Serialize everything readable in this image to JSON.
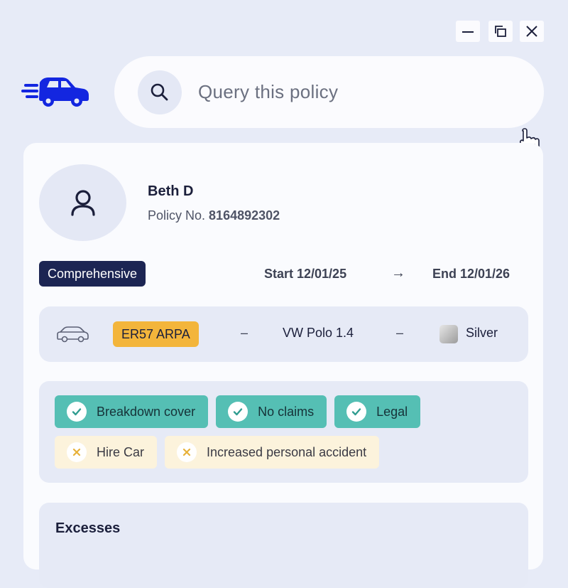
{
  "window_controls": {
    "minimize_icon": "minimize-icon",
    "restore_icon": "restore-icon",
    "close_icon": "close-icon"
  },
  "brand": {
    "logo_icon": "fast-car-icon",
    "accent_color": "#1326e0"
  },
  "search": {
    "placeholder": "Query this policy",
    "icon": "search-icon"
  },
  "policy": {
    "holder_name": "Beth D",
    "policy_no_label": "Policy No.",
    "policy_no": "8164892302",
    "cover_type": "Comprehensive",
    "start": "Start 12/01/25",
    "arrow": "→",
    "end": "End 12/01/26"
  },
  "vehicle": {
    "icon": "car-outline-icon",
    "registration": "ER57 ARPA",
    "separator": "–",
    "model": "VW Polo 1.4",
    "color": "Silver",
    "plate_color": "#f3b53b"
  },
  "features": [
    {
      "label": "Breakdown cover",
      "included": true
    },
    {
      "label": "No claims",
      "included": true
    },
    {
      "label": "Legal",
      "included": true
    },
    {
      "label": "Hire Car",
      "included": false
    },
    {
      "label": "Increased personal accident",
      "included": false
    }
  ],
  "colors": {
    "included": "#55bfb4",
    "excluded": "#fcf3dc",
    "check": "#2f9c90",
    "cross": "#e7b13a",
    "cover_badge": "#1c2553"
  },
  "excesses": {
    "title": "Excesses"
  }
}
